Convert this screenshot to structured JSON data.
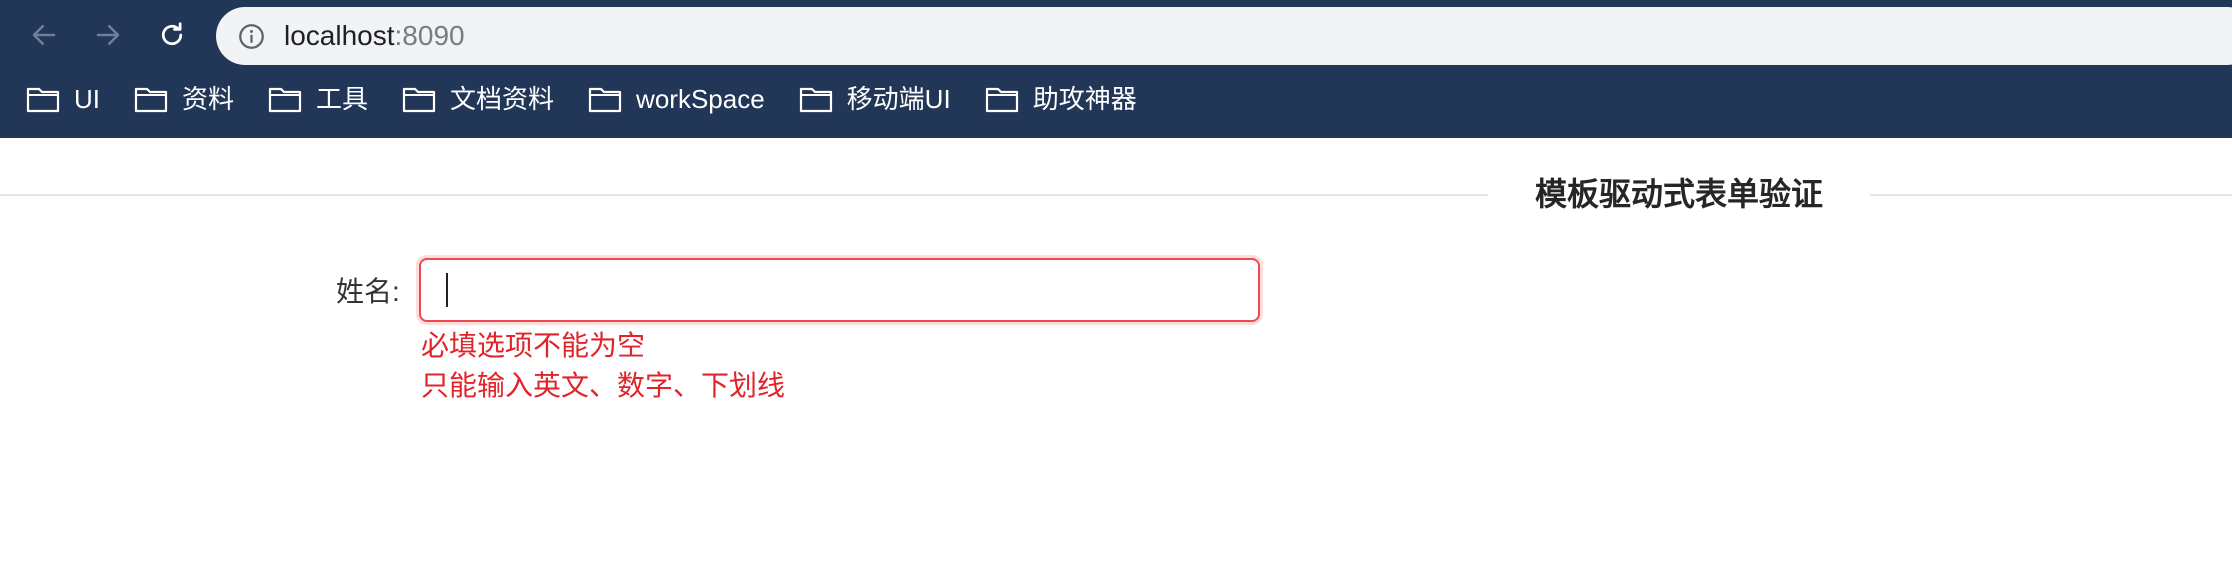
{
  "browser": {
    "url_host": "localhost",
    "url_port": ":8090",
    "bookmarks": [
      {
        "label": "UI"
      },
      {
        "label": "资料"
      },
      {
        "label": "工具"
      },
      {
        "label": "文档资料"
      },
      {
        "label": "workSpace"
      },
      {
        "label": "移动端UI"
      },
      {
        "label": "助攻神器"
      }
    ],
    "icons": {
      "back": "arrow-left-icon",
      "forward": "arrow-right-icon",
      "reload": "reload-icon",
      "info": "info-icon",
      "bookmark": "folder-icon"
    }
  },
  "page": {
    "title": "模板驱动式表单验证",
    "form": {
      "name_label": "姓名:",
      "name_value": "",
      "errors": [
        "必填选项不能为空",
        "只能输入英文、数字、下划线"
      ]
    }
  },
  "colors": {
    "toolbar_bg": "#223657",
    "error": "#e0242a",
    "field_border_error": "#ef4a4f"
  }
}
